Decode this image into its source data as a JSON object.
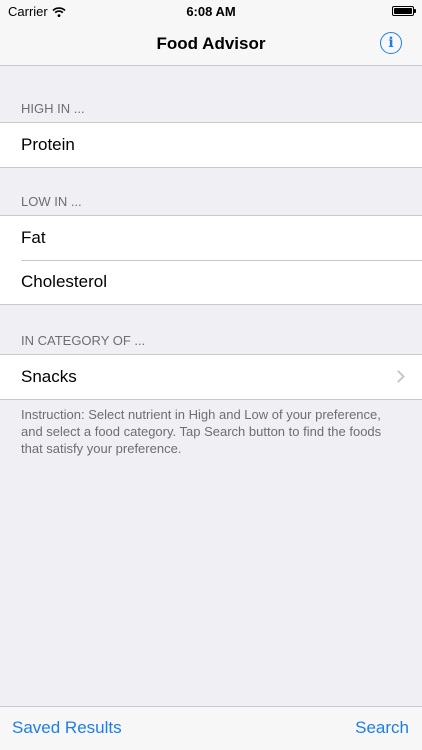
{
  "status_bar": {
    "carrier": "Carrier",
    "time": "6:08 AM",
    "battery_level": 1.0
  },
  "nav": {
    "title": "Food Advisor",
    "info_icon": "info-icon",
    "info_glyph": "i"
  },
  "sections": {
    "high": {
      "header": "HIGH IN ...",
      "items": [
        "Protein"
      ]
    },
    "low": {
      "header": "LOW IN ...",
      "items": [
        "Fat",
        "Cholesterol"
      ]
    },
    "category": {
      "header": "IN CATEGORY OF ...",
      "value": "Snacks",
      "chevron_icon": "chevron-right-icon"
    }
  },
  "instruction": "Instruction: Select nutrient in High and Low of your preference, and select a food category.  Tap Search button to find the foods that satisfy your preference.",
  "toolbar": {
    "saved_results": "Saved Results",
    "search": "Search"
  },
  "colors": {
    "accent": "#1e7ee8",
    "background": "#efeff4",
    "separator": "#c8c7cc",
    "secondary_text": "#6d6d72"
  }
}
